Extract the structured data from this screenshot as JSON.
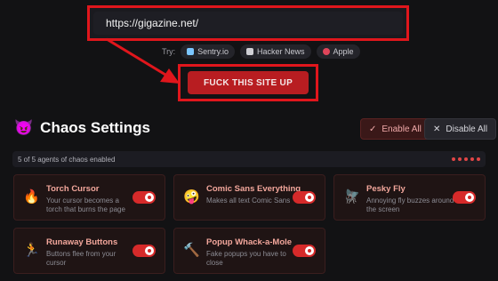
{
  "url_bar": {
    "value": "https://gigazine.net/"
  },
  "try_section": {
    "label": "Try:",
    "chips": [
      {
        "label": "Sentry.io",
        "icon": "sentry-icon",
        "color": "#7bc6ff"
      },
      {
        "label": "Hacker News",
        "icon": "hacker-news-icon",
        "color": "#cfcfd4"
      },
      {
        "label": "Apple",
        "icon": "apple-icon",
        "color": "#e0455a"
      }
    ]
  },
  "cta": {
    "label": "FUCK THIS SITE UP"
  },
  "settings": {
    "icon": "devil-icon",
    "emoji": "😈",
    "title": "Chaos Settings",
    "enable_all_label": "Enable All",
    "disable_all_label": "Disable All"
  },
  "status": {
    "text": "5 of 5 agents of chaos enabled",
    "active_count": 5
  },
  "agents": [
    {
      "title": "Torch Cursor",
      "description": "Your cursor becomes a torch that burns the page",
      "emoji": "🔥",
      "icon": "fire-icon",
      "enabled": true
    },
    {
      "title": "Comic Sans Everything",
      "description": "Makes all text Comic Sans",
      "emoji": "🤪",
      "icon": "zany-face-icon",
      "enabled": true
    },
    {
      "title": "Pesky Fly",
      "description": "Annoying fly buzzes around the screen",
      "emoji": "🪰",
      "icon": "fly-icon",
      "enabled": true
    },
    {
      "title": "Runaway Buttons",
      "description": "Buttons flee from your cursor",
      "emoji": "🏃",
      "icon": "runner-icon",
      "enabled": true
    },
    {
      "title": "Popup Whack-a-Mole",
      "description": "Fake popups you have to close",
      "emoji": "🔨",
      "icon": "hammer-icon",
      "enabled": true
    }
  ],
  "colors": {
    "accent": "#d62a2a",
    "annotation": "#e0161c",
    "background": "#121214",
    "card_title": "#f3a79c"
  }
}
